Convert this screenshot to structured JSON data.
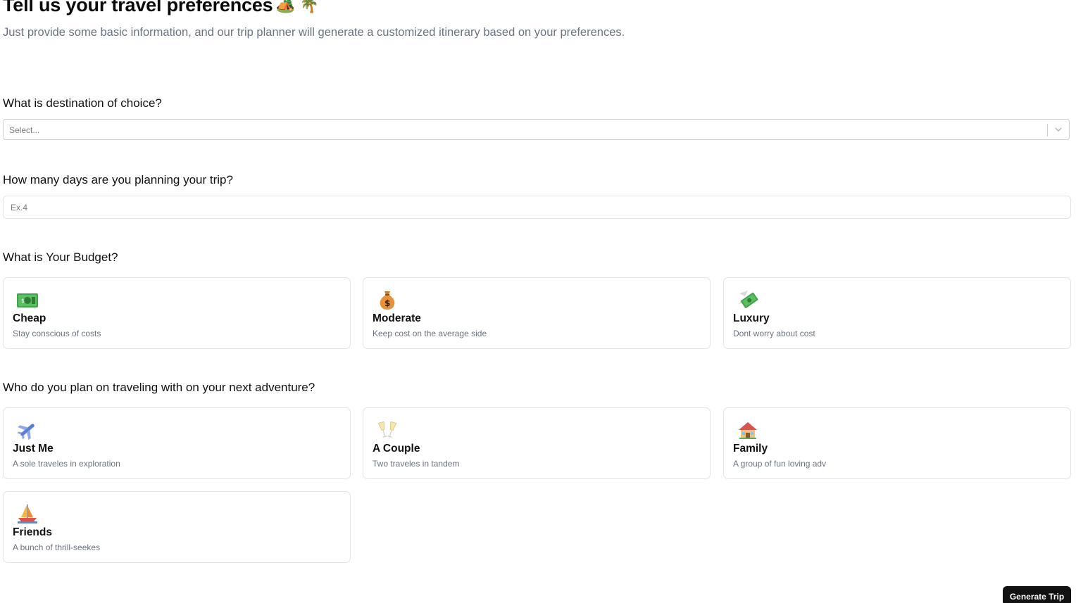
{
  "header": {
    "title": "Tell us your travel preferences",
    "title_emojis": "🏕️ 🌴",
    "subtitle": "Just provide some basic information, and our trip planner will generate a customized itinerary based on your preferences."
  },
  "destination": {
    "question": "What is destination of choice?",
    "placeholder": "Select..."
  },
  "days": {
    "question": "How many days are you planning your trip?",
    "placeholder": "Ex.4"
  },
  "budget": {
    "question": "What is Your Budget?",
    "options": [
      {
        "title": "Cheap",
        "desc": "Stay conscious of costs",
        "icon": "dollar-banknote-icon"
      },
      {
        "title": "Moderate",
        "desc": "Keep cost on the average side",
        "icon": "money-bag-icon"
      },
      {
        "title": "Luxury",
        "desc": "Dont worry about cost",
        "icon": "money-with-wings-icon"
      }
    ]
  },
  "travelers": {
    "question": "Who do you plan on traveling with on your next adventure?",
    "options": [
      {
        "title": "Just Me",
        "desc": "A sole traveles in exploration",
        "icon": "airplane-icon"
      },
      {
        "title": "A Couple",
        "desc": "Two traveles in tandem",
        "icon": "clinking-glasses-icon"
      },
      {
        "title": "Family",
        "desc": "A group of fun loving adv",
        "icon": "house-icon"
      },
      {
        "title": "Friends",
        "desc": "A bunch of thrill-seekes",
        "icon": "sailboat-icon"
      }
    ]
  },
  "actions": {
    "generate_label": "Generate Trip"
  }
}
